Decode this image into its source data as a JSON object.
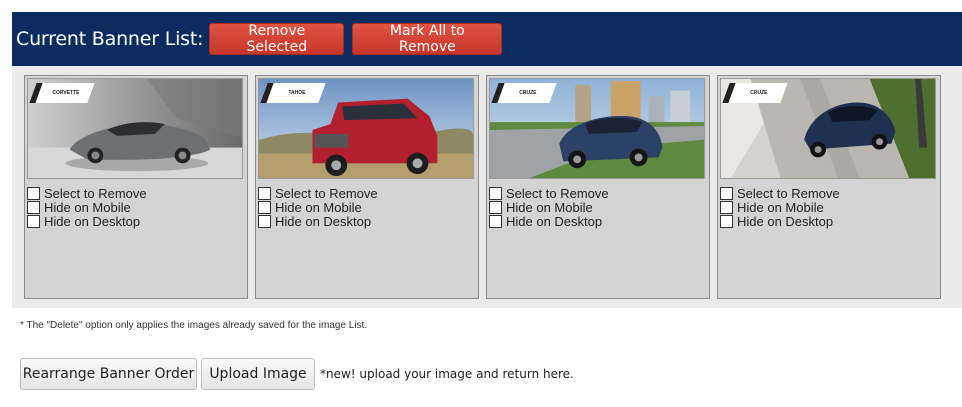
{
  "header": {
    "title": "Current Banner List:",
    "remove_selected_label": "Remove Selected",
    "mark_all_label": "Mark All to Remove"
  },
  "banners": [
    {
      "model": "CORVETTE",
      "select_label": "Select to Remove",
      "mobile_label": "Hide on Mobile",
      "desktop_label": "Hide on Desktop"
    },
    {
      "model": "TAHOE",
      "select_label": "Select to Remove",
      "mobile_label": "Hide on Mobile",
      "desktop_label": "Hide on Desktop"
    },
    {
      "model": "CRUZE",
      "select_label": "Select to Remove",
      "mobile_label": "Hide on Mobile",
      "desktop_label": "Hide on Desktop"
    },
    {
      "model": "CRUZE",
      "select_label": "Select to Remove",
      "mobile_label": "Hide on Mobile",
      "desktop_label": "Hide on Desktop"
    }
  ],
  "footnote": "* The \"Delete\" option only applies the images already saved for the image List.",
  "actions": {
    "rearrange_label": "Rearrange Banner Order",
    "upload_label": "Upload Image",
    "upload_note": "*new! upload your image and return here."
  },
  "colors": {
    "header_bg": "#0c2c5f",
    "button_red": "#d2402f"
  }
}
